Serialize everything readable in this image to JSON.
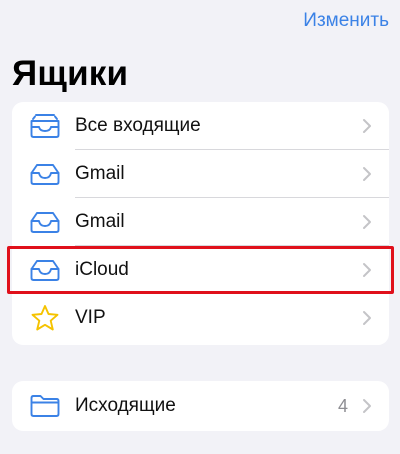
{
  "header": {
    "edit_label": "Изменить",
    "title": "Ящики"
  },
  "mailboxes": [
    {
      "label": "Все входящие",
      "icon": "all-inboxes-tray-icon"
    },
    {
      "label": "Gmail",
      "icon": "inbox-tray-icon"
    },
    {
      "label": "Gmail",
      "icon": "inbox-tray-icon"
    },
    {
      "label": "iCloud",
      "icon": "inbox-tray-icon"
    },
    {
      "label": "VIP",
      "icon": "star-icon"
    }
  ],
  "outbox": {
    "label": "Исходящие",
    "count": "4",
    "icon": "folder-icon"
  },
  "colors": {
    "accent": "#3b82e6",
    "star": "#f5c300",
    "highlight": "#e0101b",
    "background": "#f2f2f7"
  }
}
